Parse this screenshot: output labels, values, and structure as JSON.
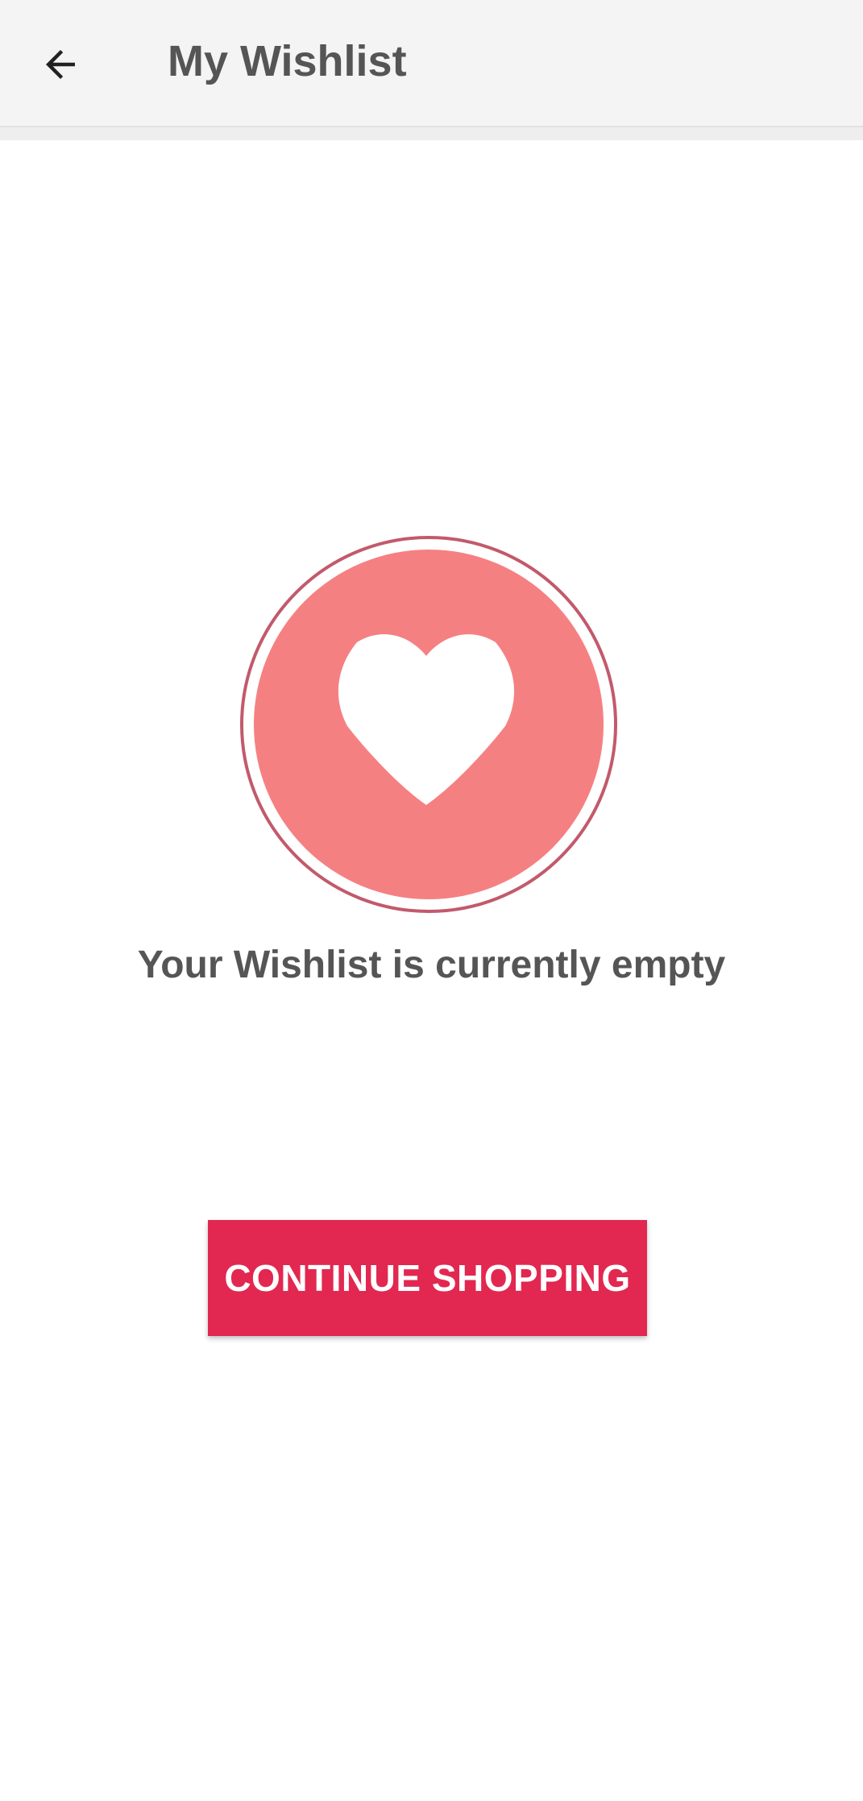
{
  "header": {
    "back_icon": "arrow-left-icon",
    "title": "My Wishlist"
  },
  "empty_state": {
    "illustration_icon": "heart-icon",
    "message": "Your Wishlist is currently empty",
    "colors": {
      "circle_fill": "#f58082",
      "circle_ring": "#c25a6c",
      "heart": "#ffffff"
    }
  },
  "actions": {
    "continue_label": "CONTINUE SHOPPING",
    "button_color": "#e22850"
  }
}
